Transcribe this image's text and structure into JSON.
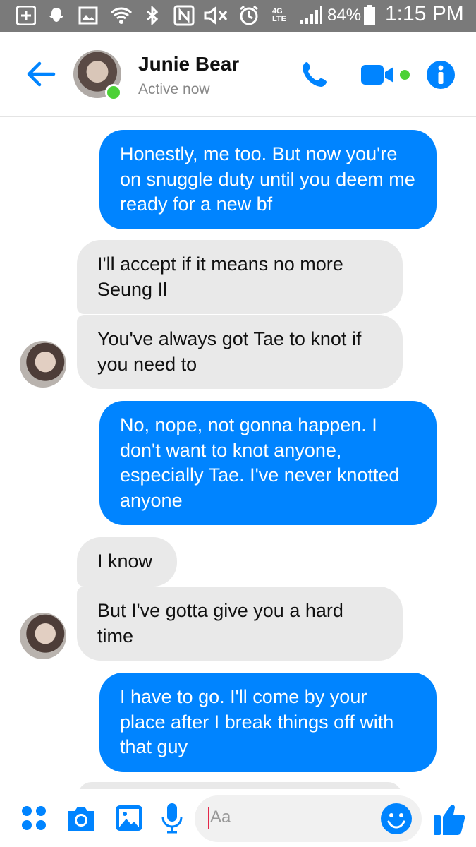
{
  "status_bar": {
    "battery": "84%",
    "time": "1:15 PM",
    "network": "4G LTE"
  },
  "header": {
    "contact_name": "Junie Bear",
    "presence": "Active now"
  },
  "messages": [
    {
      "direction": "out",
      "text": "Honestly, me too. But now you're on snuggle duty until you deem me ready for a new bf"
    },
    {
      "direction": "in",
      "text": "I'll accept if it means no more Seung Il"
    },
    {
      "direction": "in",
      "text": "You've always got Tae to knot if you need to"
    },
    {
      "direction": "out",
      "text": "No, nope, not gonna happen. I don't want to knot anyone, especially Tae. I've never knotted anyone"
    },
    {
      "direction": "in",
      "text": "I know"
    },
    {
      "direction": "in",
      "text": "But I've gotta give you a hard time"
    },
    {
      "direction": "out",
      "text": "I have to go. I'll come by your place after I break things off with that guy"
    }
  ],
  "composer": {
    "placeholder": "Aa"
  },
  "colors": {
    "accent": "#0084ff",
    "incoming_bubble": "#e9e9e9",
    "active_dot": "#4cd137",
    "status_bar": "#7a7a7a"
  },
  "icons": [
    "plus-icon",
    "snapchat-icon",
    "gallery-icon",
    "wifi-icon",
    "bluetooth-icon",
    "nfc-icon",
    "mute-icon",
    "alarm-icon",
    "signal-icon",
    "battery-icon",
    "back-arrow-icon",
    "phone-icon",
    "video-camera-icon",
    "info-icon",
    "apps-grid-icon",
    "camera-icon",
    "image-icon",
    "microphone-icon",
    "emoji-icon",
    "thumbs-up-icon"
  ]
}
